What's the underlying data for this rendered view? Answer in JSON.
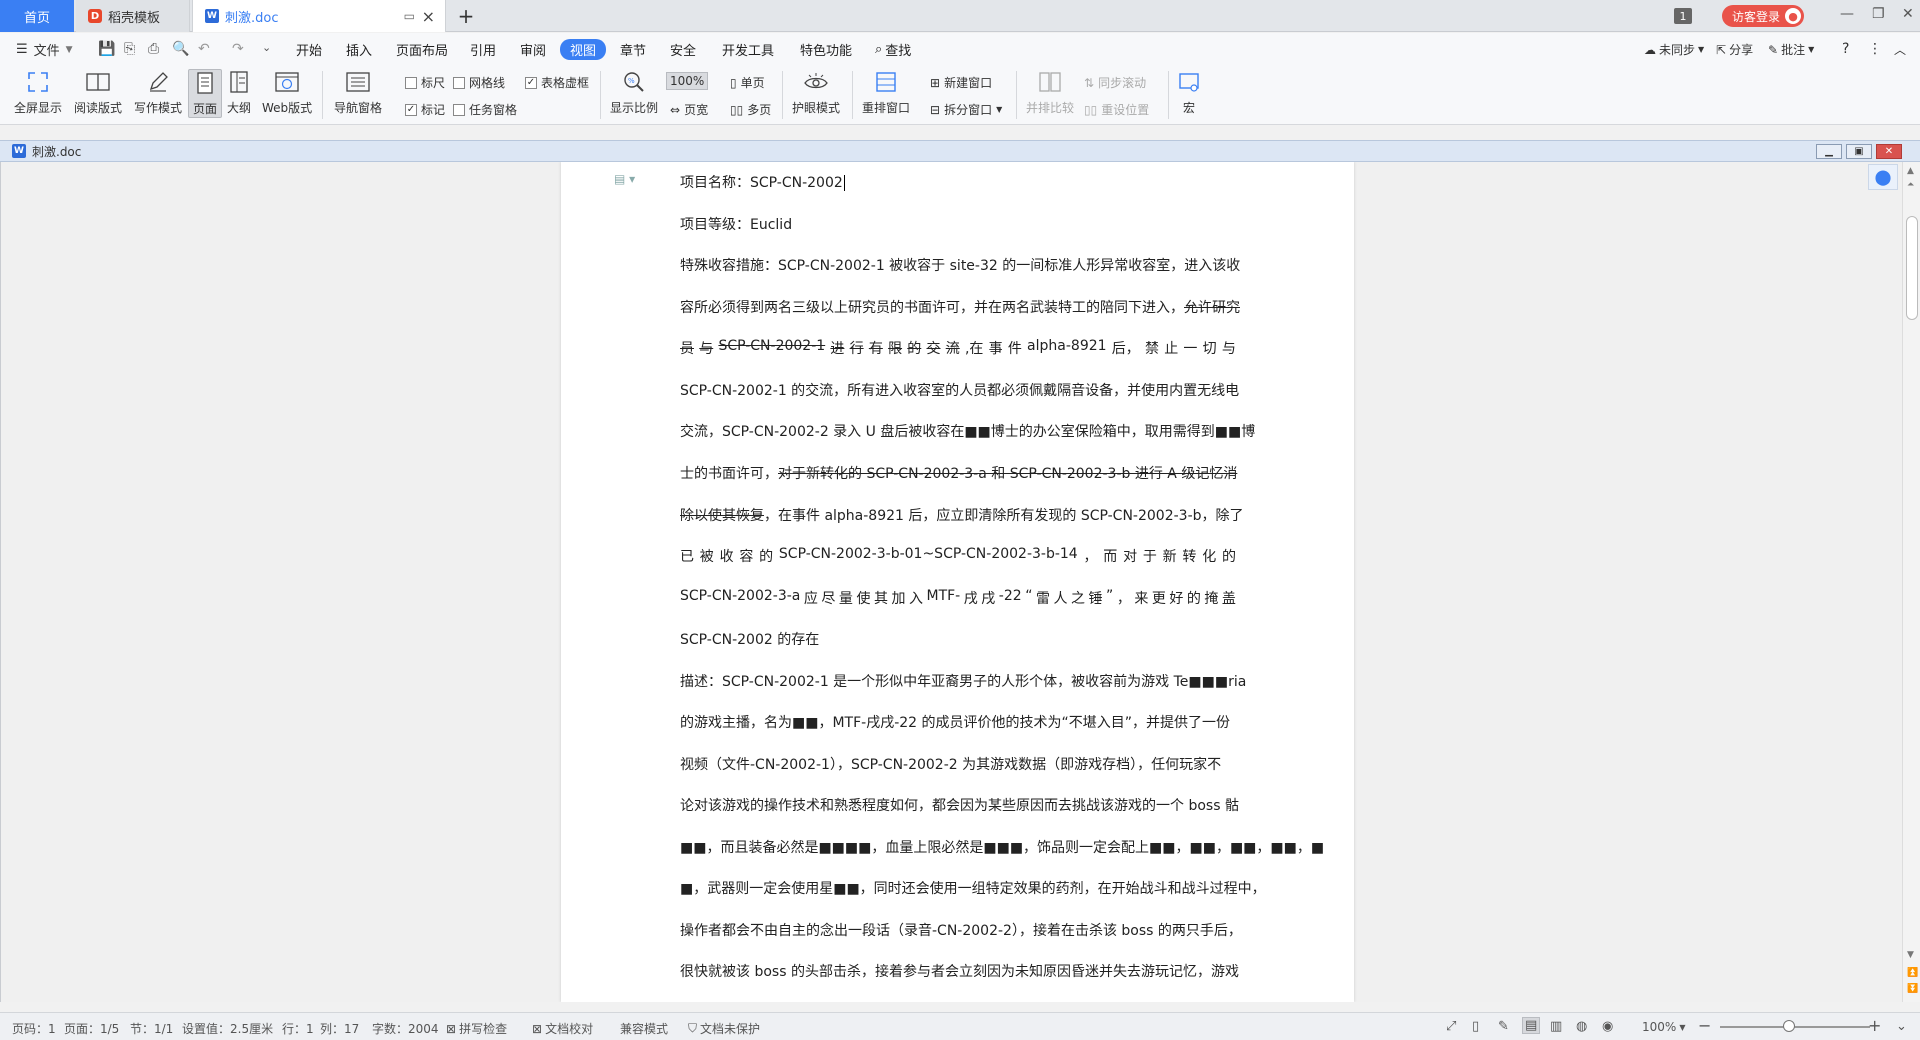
{
  "tabs": {
    "home": "首页",
    "template": "稻壳模板",
    "doc": "刺激.doc",
    "add": "+"
  },
  "titlebar": {
    "badge": "1",
    "login": "访客登录"
  },
  "menu": {
    "file": "文件",
    "items": [
      "开始",
      "插入",
      "页面布局",
      "引用",
      "审阅",
      "视图",
      "章节",
      "安全",
      "开发工具",
      "特色功能"
    ],
    "active": "视图",
    "search": "查找",
    "sync": "未同步",
    "share": "分享",
    "comment": "批注",
    "help": "?"
  },
  "ribbon": {
    "fullscreen": "全屏显示",
    "read_mode": "阅读版式",
    "write_mode": "写作模式",
    "page_view": "页面",
    "outline": "大纲",
    "web_view": "Web版式",
    "nav_pane": "导航窗格",
    "ruler": "标尺",
    "gridlines": "网格线",
    "table_dashed": "表格虚框",
    "marks": "标记",
    "task_pane": "任务窗格",
    "display_ratio": "显示比例",
    "zoom": "100%",
    "single_page": "单页",
    "page_width": "页宽",
    "multi_page": "多页",
    "eye_mode": "护眼模式",
    "rearrange": "重排窗口",
    "new_window": "新建窗口",
    "split_window": "拆分窗口",
    "side_by_side": "并排比较",
    "sync_scroll": "同步滚动",
    "reset_pos": "重设位置",
    "macro": "宏"
  },
  "docwin": {
    "title": "刺激.doc"
  },
  "document": {
    "title_line": "项目名称：SCP-CN-2002",
    "class_line": "项目等级：Euclid",
    "p1_l1": "特殊收容措施：SCP-CN-2002-1 被收容于 site-32 的一间标准人形异常收容室，进入该收",
    "p1_l2_a": "容所必须得到两名三级以上研究员的书面许可，并在两名武装特工的陪同下进入，",
    "p1_l2_b": "允许研究",
    "p1_l3_strike": [
      "员",
      "与",
      "SCP-CN-2002-1",
      "进",
      "行",
      "有",
      "限",
      "的",
      "交",
      "流"
    ],
    "p1_l3_rest": [
      ",在",
      "事",
      "件",
      "alpha-8921",
      "后，",
      "禁",
      "止",
      "一",
      "切",
      "与"
    ],
    "p1_l4": "SCP-CN-2002-1 的交流，所有进入收容室的人员都必须佩戴隔音设备，并使用内置无线电",
    "p1_l5": "交流，SCP-CN-2002-2 录入 U 盘后被收容在■■博士的办公室保险箱中，取用需得到■■博",
    "p1_l6_a": "士的书面许可，",
    "p1_l6_b": "对于新转化的 SCP-CN-2002-3-a 和 SCP-CN-2002-3-b 进行 A 级记忆消",
    "p1_l7_a": "除以使其恢复",
    "p1_l7_b": "，在事件 alpha-8921 后，应立即清除所有发现的 SCP-CN-2002-3-b，除了",
    "p1_l8": [
      "已",
      "被",
      "收",
      "容",
      "的",
      "SCP-CN-2002-3-b-01~SCP-CN-2002-3-b-14",
      "，",
      "而",
      "对",
      "于",
      "新",
      "转",
      "化",
      "的"
    ],
    "p1_l9": [
      "SCP-CN-2002-3-a",
      "应",
      "尽",
      "量",
      "使",
      "其",
      "加",
      "入",
      "MTF-",
      "戌",
      "戌",
      "-22",
      "“",
      "雷",
      "人",
      "之",
      "锤",
      "”",
      "，",
      "来",
      "更",
      "好",
      "的",
      "掩",
      "盖"
    ],
    "p1_l10": "SCP-CN-2002 的存在",
    "p2_l1": "描述：SCP-CN-2002-1 是一个形似中年亚裔男子的人形个体，被收容前为游戏 Te■■■ria",
    "p2_l2": "的游戏主播，名为■■，MTF-戌戌-22 的成员评价他的技术为“不堪入目”，并提供了一份",
    "p2_l3": "视频（文件-CN-2002-1），SCP-CN-2002-2 为其游戏数据（即游戏存档），任何玩家不",
    "p2_l4": "论对该游戏的操作技术和熟悉程度如何，都会因为某些原因而去挑战该游戏的一个 boss 骷",
    "p2_l5": "■■，而且装备必然是■■■■，血量上限必然是■■■，饰品则一定会配上■■，■■，■■，■■，■",
    "p2_l6": "■，武器则一定会使用星■■，同时还会使用一组特定效果的药剂，在开始战斗和战斗过程中，",
    "p2_l7": "操作者都会不由自主的念出一段话（录音-CN-2002-2），接着在击杀该 boss 的两只手后，",
    "p2_l8": "很快就被该 boss 的头部击杀，接着参与者会立刻因为未知原因昏迷并失去游玩记忆，游戏"
  },
  "status": {
    "page_code": "页码：1",
    "pages": "页面：1/5",
    "section": "节：1/1",
    "setting": "设置值：2.5厘米",
    "row": "行：1",
    "col": "列：17",
    "words": "字数：2004",
    "spell": "拼写检查",
    "proof": "文档校对",
    "compat": "兼容模式",
    "protect": "文档未保护",
    "zoom": "100%",
    "zoom_level_percent": 100
  }
}
